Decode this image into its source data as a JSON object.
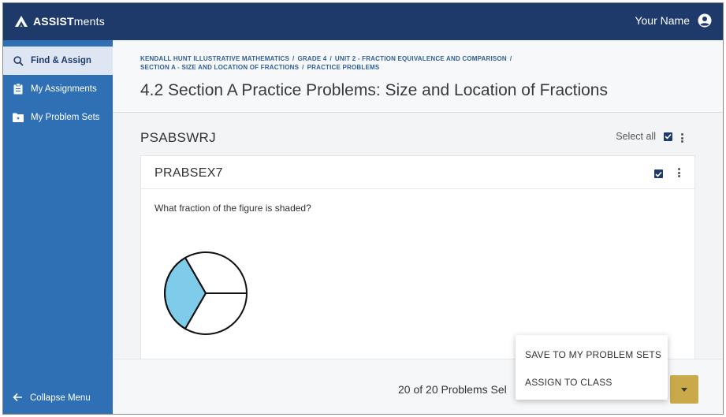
{
  "topbar": {
    "logo_bold": "ASSIST",
    "logo_light": "ments",
    "user_name": "Your Name",
    "user_icon": "user-circle-icon"
  },
  "sidebar": {
    "items": [
      {
        "label": "Find & Assign",
        "icon": "search-icon",
        "active": true
      },
      {
        "label": "My Assignments",
        "icon": "clipboard-icon",
        "active": false
      },
      {
        "label": "My Problem Sets",
        "icon": "folder-icon",
        "active": false
      }
    ],
    "collapse_label": "Collapse Menu"
  },
  "breadcrumb": {
    "parts": [
      "KENDALL HUNT ILLUSTRATIVE MATHEMATICS",
      "GRADE 4",
      "UNIT 2 - FRACTION EQUIVALENCE AND COMPARISON",
      "SECTION A - SIZE AND LOCATION OF FRACTIONS",
      "PRACTICE PROBLEMS"
    ]
  },
  "page_title": "4.2 Section A Practice Problems: Size and Location of Fractions",
  "problem_set": {
    "id": "PSABSWRJ",
    "select_all_label": "Select all",
    "select_all_checked": true
  },
  "problem": {
    "id": "PRABSEX7",
    "checked": true,
    "question": "What fraction of the figure is shaded?"
  },
  "footer": {
    "count_text": "20 of 20 Problems Sel"
  },
  "menu": {
    "items": [
      "SAVE TO MY PROBLEM SETS",
      "ASSIGN TO CLASS"
    ]
  },
  "colors": {
    "topbar": "#1e3a6b",
    "sidebar": "#2f6fb4",
    "accent_button": "#c9a94a",
    "shaded_fill": "#7fcbea"
  }
}
